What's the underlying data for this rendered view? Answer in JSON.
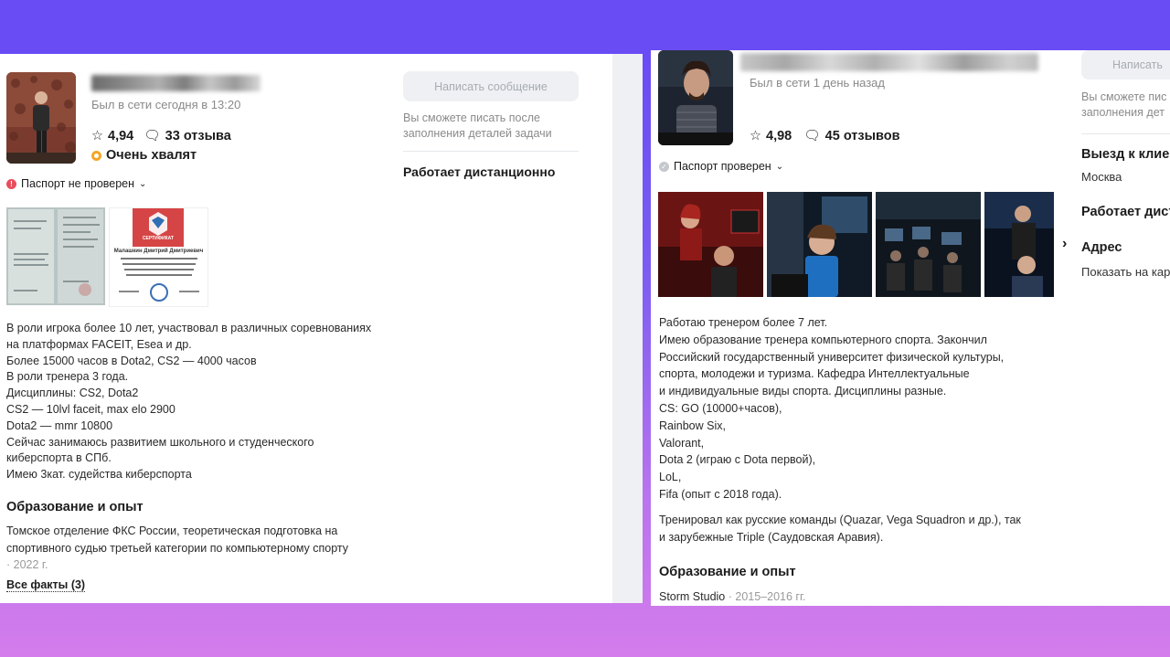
{
  "left": {
    "last_seen": "Был в сети сегодня в 13:20",
    "rating": "4,94",
    "reviews": "33 отзыва",
    "badge": "Очень хвалят",
    "passport": "Паспорт не проверен",
    "message_button": "Написать сообщение",
    "message_note": "Вы сможете писать после заполнения деталей задачи",
    "remote": "Работает дистанционно",
    "bio_lines": [
      "В роли игрока более 10 лет, участвовал в различных соревнованиях",
      "на платформах FACEIT, Esea и др.",
      "Более 15000 часов в Dota2, CS2 — 4000 часов",
      "В роли тренера 3 года.",
      "Дисциплины: CS2, Dota2",
      "CS2 — 10lvl faceit, max elo 2900",
      "Dota2 — mmr 10800",
      "Сейчас занимаюсь развитием школьного и студенческого",
      "киберспорта в СПб.",
      "Имею 3кат. судейства киберспорта"
    ],
    "education_title": "Образование и опыт",
    "education_text_1": "Томское отделение ФКС России, теоретическая подготовка на",
    "education_text_2": "спортивного судью третьей категории по компьютерному спорту",
    "education_year": "· 2022 г.",
    "all_facts": "Все факты (3)",
    "cert": {
      "title": "СЕРТИФИКАТ",
      "name": "Малашкин Дмитрий Дмитриевич"
    }
  },
  "right": {
    "last_seen": "Был в сети 1 день назад",
    "rating": "4,98",
    "reviews": "45 отзывов",
    "passport": "Паспорт проверен",
    "message_button": "Написать",
    "message_note_1": "Вы сможете пис",
    "message_note_2": "заполнения дет",
    "visit_title": "Выезд к клие",
    "visit_city": "Москва",
    "remote": "Работает дист",
    "address_title": "Адрес",
    "address_link": "Показать на кар",
    "bio_lines": [
      "Работаю тренером более 7 лет.",
      "Имею образование тренера компьютерного спорта. Закончил",
      "Российский государственный университет физической культуры,",
      "спорта, молодежи и туризма. Кафедра Интеллектуальные",
      "и индивидуальные виды спорта. Дисциплины разные.",
      "CS: GO (10000+часов),",
      "Rainbow Six,",
      "Valorant,",
      "Dota 2 (играю с Dota первой),",
      "LoL,",
      "Fifa (опыт с 2018 года)."
    ],
    "teams_1": "Тренировал как русские команды (Quazar, Vega Squadron и др.), так",
    "teams_2": "и зарубежные Triple (Саудовская Аравия).",
    "education_title": "Образование и опыт",
    "studio": "Storm Studio",
    "studio_years": "· 2015–2016 гг."
  },
  "colors": {
    "accent_star": "#1c1c1c",
    "badge": "#f5a623",
    "passport_unverified": "#e94d5d",
    "button_bg": "#eef0f3",
    "banner_top": "#6a4cf5",
    "banner_bottom": "#d47cec"
  },
  "icons": [
    "star-icon",
    "comment-icon",
    "chevron-down-icon",
    "chevron-right-icon",
    "warning-dot-icon",
    "check-dot-icon",
    "badge-icon"
  ]
}
